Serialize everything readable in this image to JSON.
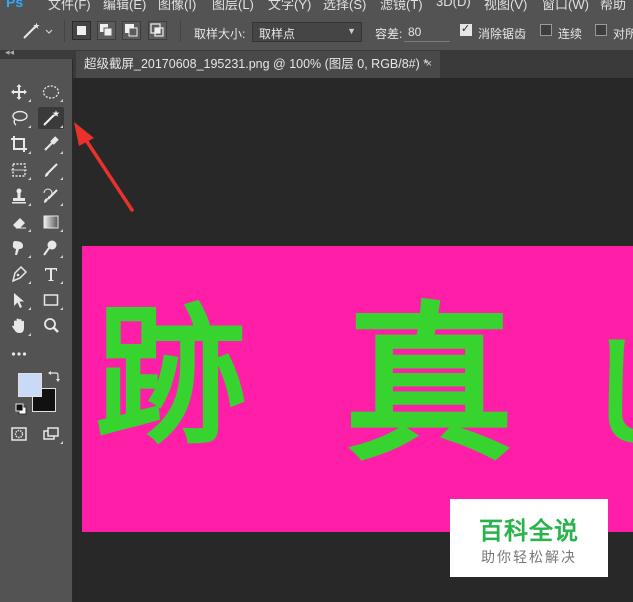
{
  "app": {
    "logo": "Ps"
  },
  "menu": [
    "文件(F)",
    "编辑(E)",
    "图像(I)",
    "图层(L)",
    "文字(Y)",
    "选择(S)",
    "滤镜(T)",
    "3D(D)",
    "视图(V)",
    "窗口(W)",
    "帮助"
  ],
  "options": {
    "sample_size_label": "取样大小:",
    "sample_size_value": "取样点",
    "tolerance_label": "容差:",
    "tolerance_value": "80",
    "antialias_label": "消除锯齿",
    "antialias_checked": true,
    "contiguous_label": "连续",
    "contiguous_checked": false,
    "sample_all_label": "对所"
  },
  "document": {
    "tab_title": "超级截屏_20170608_195231.png @ 100% (图层 0, RGB/8#) *",
    "close_symbol": "×"
  },
  "canvas_text": [
    "跡",
    "真",
    "し"
  ],
  "watermark": {
    "title": "百科全说",
    "subtitle": "助你轻松解决"
  },
  "colors": {
    "foreground": "#c8daf5",
    "background": "#111111",
    "image_bg": "#ff1ea8",
    "image_text": "#37d32e",
    "arrow": "#e8322b"
  },
  "tools": [
    "move-tool",
    "marquee-tool",
    "lasso-tool",
    "magic-wand-tool",
    "crop-tool",
    "eyedropper-tool",
    "frame-tool",
    "brush-tool",
    "stamp-tool",
    "history-brush-tool",
    "eraser-tool",
    "gradient-tool",
    "smudge-tool",
    "dodge-tool",
    "pen-tool",
    "type-tool",
    "path-select-tool",
    "rectangle-tool",
    "hand-tool",
    "zoom-tool",
    "more-tools",
    "quick-mask",
    "screen-mode"
  ]
}
